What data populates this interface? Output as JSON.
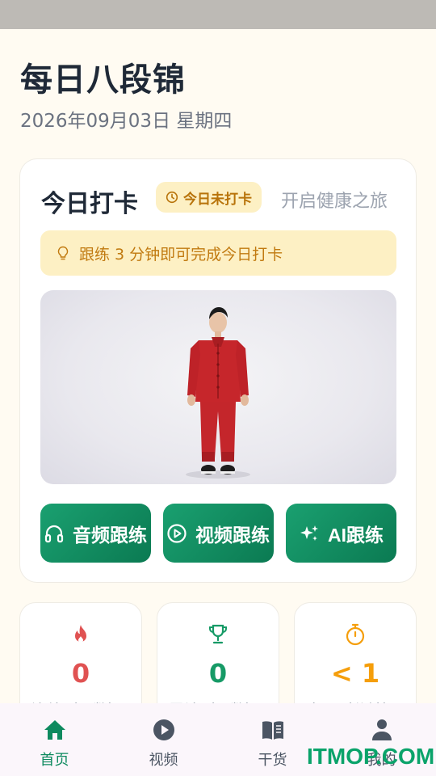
{
  "header": {
    "title": "每日八段锦",
    "date": "2026年09月03日 星期四"
  },
  "checkin": {
    "title": "今日打卡",
    "status_badge": "今日未打卡",
    "subtitle": "开启健康之旅",
    "tip": "跟练 3 分钟即可完成今日打卡",
    "buttons": [
      {
        "label": "音频跟练",
        "icon": "headphones-icon"
      },
      {
        "label": "视频跟练",
        "icon": "play-circle-icon"
      },
      {
        "label": "AI跟练",
        "icon": "sparkles-icon"
      }
    ]
  },
  "stats": [
    {
      "value": "0",
      "label": "连续（天数）",
      "icon": "fire-icon",
      "color": "#e05252"
    },
    {
      "value": "0",
      "label": "累计（天数）",
      "icon": "trophy-icon",
      "color": "#169a66"
    },
    {
      "value": "< 1",
      "label": "今日（分钟）",
      "icon": "stopwatch-icon",
      "color": "#f59e0b"
    }
  ],
  "tabs": [
    {
      "label": "首页",
      "icon": "home-icon",
      "active": true
    },
    {
      "label": "视频",
      "icon": "play-icon",
      "active": false
    },
    {
      "label": "干货",
      "icon": "book-icon",
      "active": false
    },
    {
      "label": "我的",
      "icon": "person-icon",
      "active": false
    }
  ],
  "watermark": "ITMOP.COM",
  "colors": {
    "accent": "#0e8a5f",
    "badge_bg": "#fdf0c4",
    "badge_text": "#b8730a"
  }
}
